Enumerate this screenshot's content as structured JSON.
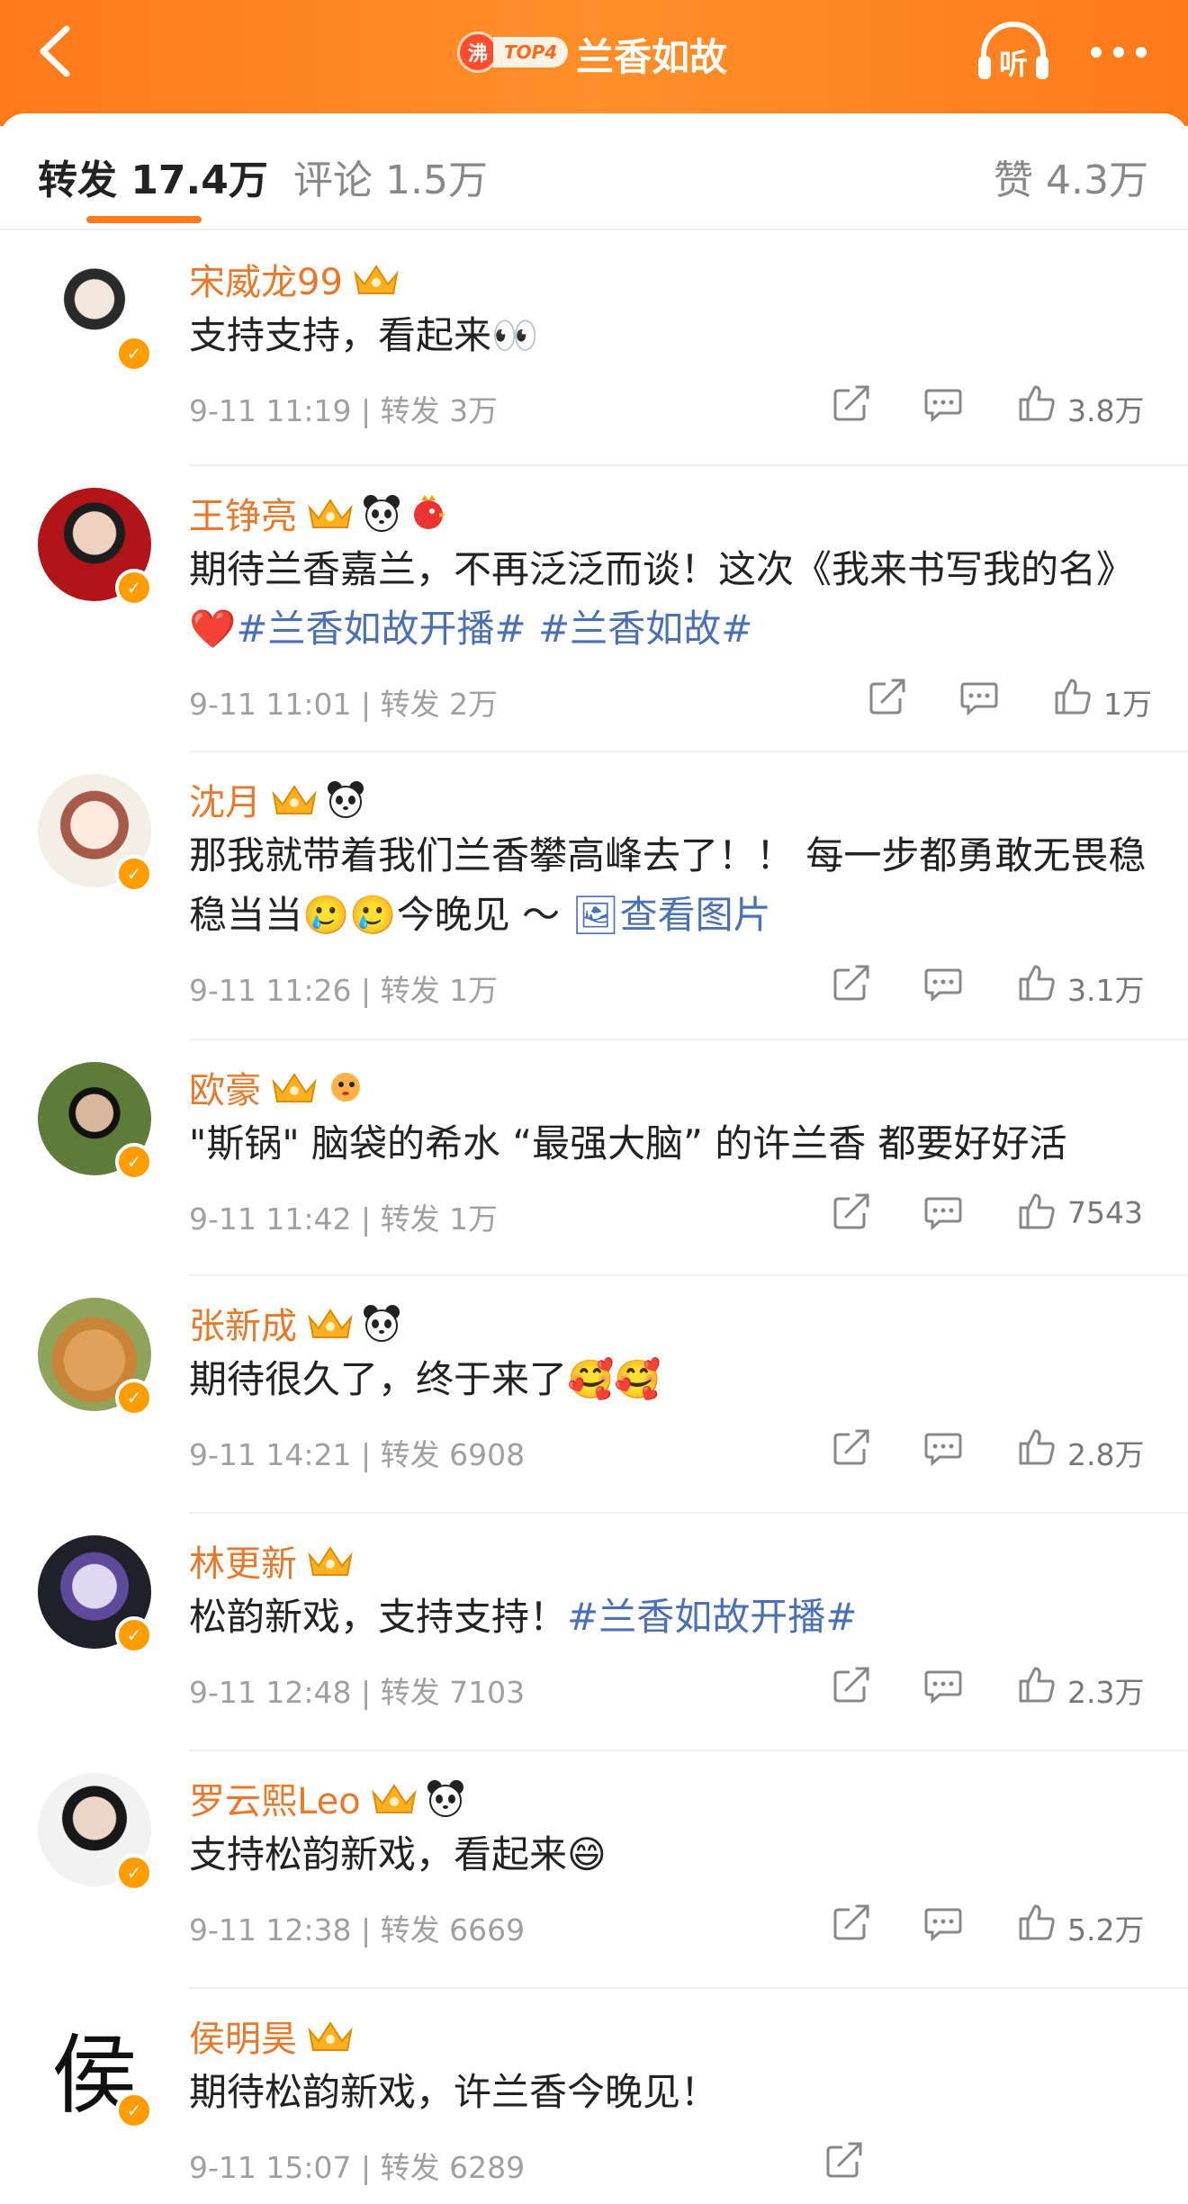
{
  "header": {
    "title": "兰香如故",
    "hot_badge": "沸",
    "hot_rank": "TOP4",
    "listen_label": "听"
  },
  "tabs": [
    {
      "label": "转发 17.4万",
      "active": true
    },
    {
      "label": "评论 1.5万",
      "active": false
    },
    {
      "label": "赞 4.3万",
      "active": false
    }
  ],
  "reposts": [
    {
      "user": "宋威龙99",
      "text": [
        {
          "t": "支持支持，看起来👀",
          "tag": false
        }
      ],
      "time": "9-11 11:19",
      "repost": "转发 3万",
      "likes": "3.8万"
    },
    {
      "user": "王铮亮",
      "text": [
        {
          "t": "期待兰香嘉兰，不再泛泛而谈！这次《我来书写我的名》❤️",
          "tag": false
        },
        {
          "t": "#兰香如故开播#",
          "tag": true
        },
        {
          "t": " ",
          "tag": false
        },
        {
          "t": "#兰香如故#",
          "tag": true
        }
      ],
      "time": "9-11 11:01",
      "repost": "转发 2万",
      "likes": "1万"
    },
    {
      "user": "沈月",
      "text": [
        {
          "t": "那我就带着我们兰香攀高峰去了！！ 每一步都勇敢无畏稳稳当当🥲🥲今晚见 ～ ",
          "tag": false
        },
        {
          "t": "🖼查看图片",
          "tag": true
        }
      ],
      "time": "9-11 11:26",
      "repost": "转发 1万",
      "likes": "3.1万"
    },
    {
      "user": "欧豪",
      "text": [
        {
          "t": "\"斯锅\" 脑袋的希水 “最强大脑” 的许兰香 都要好好活",
          "tag": false
        }
      ],
      "time": "9-11 11:42",
      "repost": "转发 1万",
      "likes": "7543"
    },
    {
      "user": "张新成",
      "text": [
        {
          "t": "期待很久了，终于来了🥰🥰",
          "tag": false
        }
      ],
      "time": "9-11 14:21",
      "repost": "转发 6908",
      "likes": "2.8万"
    },
    {
      "user": "林更新",
      "text": [
        {
          "t": "松韵新戏，支持支持！",
          "tag": false
        },
        {
          "t": "#兰香如故开播#",
          "tag": true
        }
      ],
      "time": "9-11 12:48",
      "repost": "转发 7103",
      "likes": "2.3万"
    },
    {
      "user": "罗云熙Leo",
      "text": [
        {
          "t": "支持松韵新戏，看起来😄",
          "tag": false
        }
      ],
      "time": "9-11 12:38",
      "repost": "转发 6669",
      "likes": "5.2万"
    },
    {
      "user": "侯明昊",
      "text": [
        {
          "t": "期待松韵新戏，许兰香今晚见！",
          "tag": false
        }
      ],
      "time": "9-11 15:07",
      "repost": "转发 6289",
      "likes": ""
    }
  ],
  "avatar_glyph_8": "侯",
  "colors": {
    "accent": "#ff7a1a",
    "username": "#e8782a",
    "hashtag": "#4c70b4",
    "meta": "#a0a0a0"
  }
}
